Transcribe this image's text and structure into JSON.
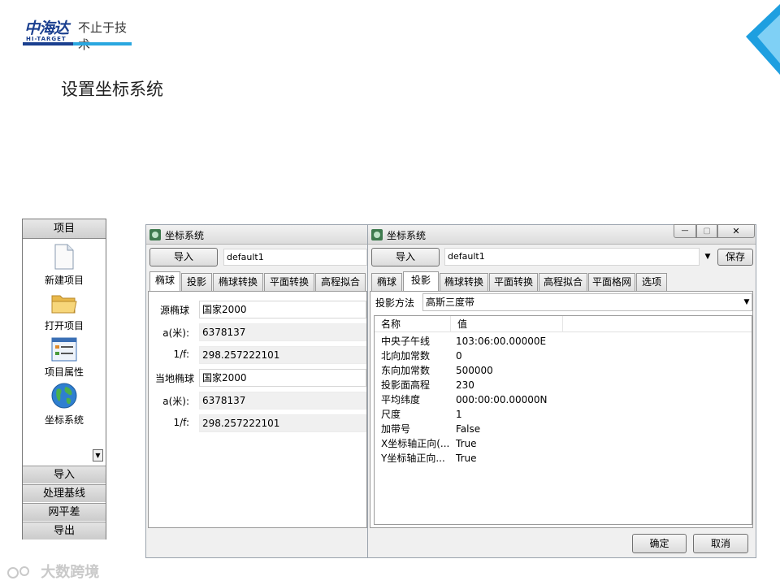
{
  "slide": {
    "logo_cn": "中海达",
    "logo_en": "HI-TARGET",
    "slogan": "不止于技术",
    "title": "设置坐标系统"
  },
  "left_panel": {
    "header": "项目",
    "items": [
      {
        "label": "新建项目",
        "icon": "new-file-icon"
      },
      {
        "label": "打开项目",
        "icon": "folder-icon"
      },
      {
        "label": "项目属性",
        "icon": "properties-icon"
      },
      {
        "label": "坐标系统",
        "icon": "globe-icon"
      }
    ],
    "scroll_glyph": "▼",
    "buttons": [
      "导入",
      "处理基线",
      "网平差",
      "导出"
    ]
  },
  "dialog_left": {
    "title": "坐标系统",
    "import_label": "导入",
    "name_value": "default1",
    "tabs": [
      "椭球",
      "投影",
      "椭球转换",
      "平面转换",
      "高程拟合"
    ],
    "active_tab": 0,
    "fields": [
      {
        "label": "源椭球",
        "value": "国家2000",
        "editable": true
      },
      {
        "label": "a(米):",
        "value": "6378137",
        "editable": false
      },
      {
        "label": "1/f:",
        "value": "298.257222101",
        "editable": false
      },
      {
        "label": "当地椭球",
        "value": "国家2000",
        "editable": true
      },
      {
        "label": "a(米):",
        "value": "6378137",
        "editable": false
      },
      {
        "label": "1/f:",
        "value": "298.257222101",
        "editable": false
      }
    ]
  },
  "dialog_right": {
    "title": "坐标系统",
    "import_label": "导入",
    "name_value": "default1",
    "save_label": "保存",
    "tabs": [
      "椭球",
      "投影",
      "椭球转换",
      "平面转换",
      "高程拟合",
      "平面格网",
      "选项"
    ],
    "active_tab": 1,
    "projection_label": "投影方法",
    "projection_value": "高斯三度带",
    "table_headers": [
      "名称",
      "值"
    ],
    "rows": [
      {
        "name": "中央子午线",
        "value": "103:06:00.00000E"
      },
      {
        "name": "北向加常数",
        "value": "0"
      },
      {
        "name": "东向加常数",
        "value": "500000"
      },
      {
        "name": "投影面高程",
        "value": "230"
      },
      {
        "name": "平均纬度",
        "value": "000:00:00.00000N"
      },
      {
        "name": "尺度",
        "value": "1"
      },
      {
        "name": "加带号",
        "value": "False"
      },
      {
        "name": "X坐标轴正向(...",
        "value": "True"
      },
      {
        "name": "Y坐标轴正向...",
        "value": "True"
      }
    ],
    "ok_label": "确定",
    "cancel_label": "取消",
    "win_min": "—",
    "win_max": "▢",
    "win_close": "✕"
  },
  "watermark": "大数跨境",
  "colors": {
    "brand_blue": "#1a3f8f",
    "accent_cyan": "#2aa7e0"
  }
}
